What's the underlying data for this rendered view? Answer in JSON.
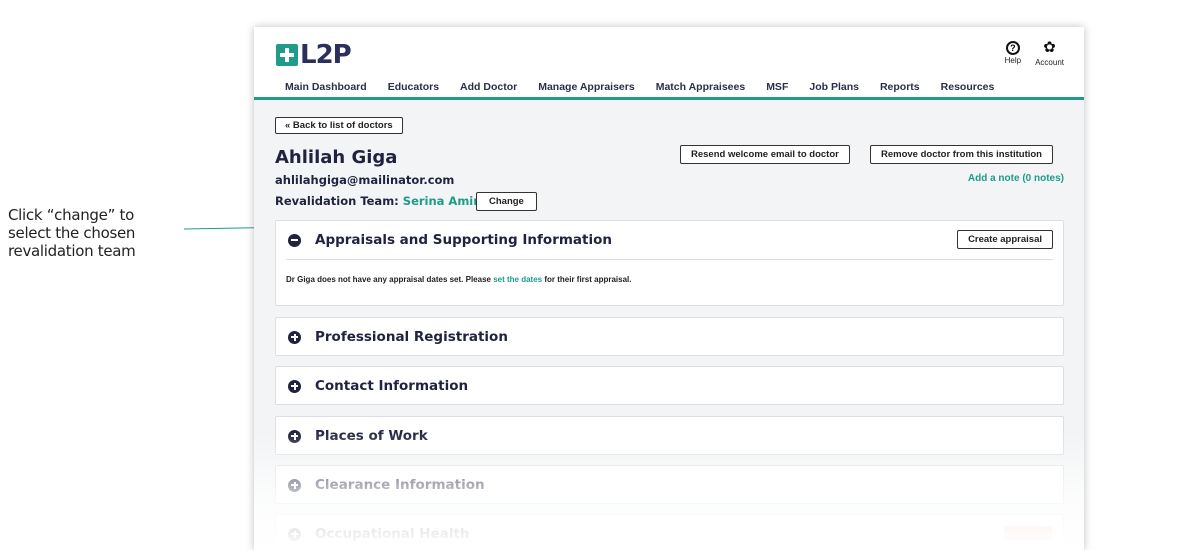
{
  "annotation": {
    "text_lines": [
      "Click “change” to",
      "select the chosen",
      "revalidation team"
    ]
  },
  "header": {
    "logo_text": "L2P",
    "help_label": "Help",
    "account_label": "Account",
    "help_icon": "question-circle-icon",
    "account_icon": "gear-icon"
  },
  "nav": {
    "items": [
      {
        "label": "Main Dashboard"
      },
      {
        "label": "Educators"
      },
      {
        "label": "Add Doctor"
      },
      {
        "label": "Manage Appraisers"
      },
      {
        "label": "Match Appraisees"
      },
      {
        "label": "MSF"
      },
      {
        "label": "Job Plans"
      },
      {
        "label": "Reports"
      },
      {
        "label": "Resources"
      }
    ]
  },
  "doctor": {
    "back_label": "« Back to list of doctors",
    "name": "Ahlilah Giga",
    "email": "ahlilahgiga@mailinator.com",
    "resend_label": "Resend welcome email to doctor",
    "remove_label": "Remove doctor from this institution",
    "note_label": "Add a note (0 notes)",
    "revalidation_label": "Revalidation Team:",
    "revalidation_value": "Serina Amin",
    "change_label": "Change"
  },
  "panels": {
    "appraisals": {
      "title": "Appraisals and Supporting Information",
      "create_label": "Create appraisal",
      "body_before": "Dr Giga does not have any appraisal dates set. Please ",
      "body_link": "set the dates",
      "body_after": " for their first appraisal."
    },
    "registration": {
      "title": "Professional Registration"
    },
    "contact": {
      "title": "Contact Information"
    },
    "places": {
      "title": "Places of Work"
    },
    "clearance": {
      "title": "Clearance Information"
    },
    "occupational": {
      "title": "Occupational Health"
    }
  },
  "colors": {
    "accent": "#1f9b8a",
    "brand_dark": "#2a2f5b"
  }
}
